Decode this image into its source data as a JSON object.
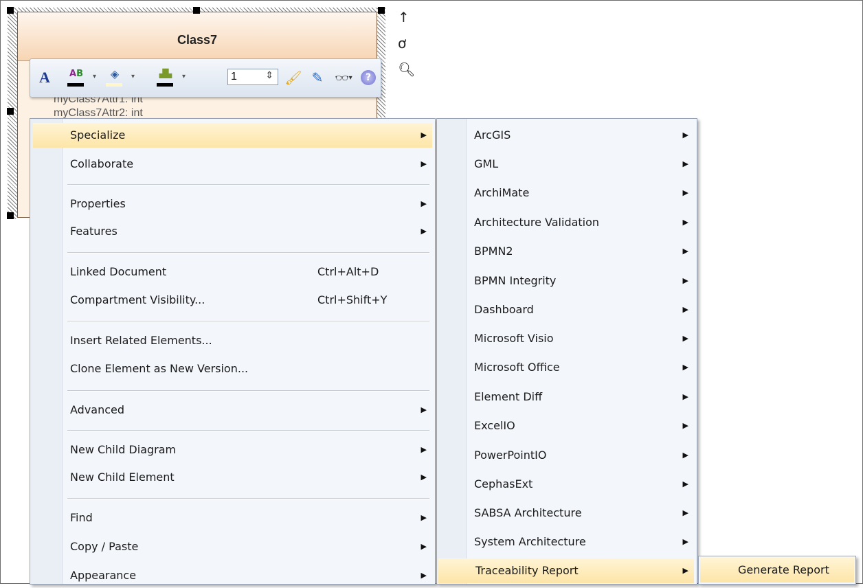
{
  "class_element": {
    "name": "Class7",
    "attributes": [
      "myClass7Attr1: int",
      "myClass7Attr2: int"
    ]
  },
  "side_tools": {
    "arrow_icon": "up-arrow",
    "link_icon": "link",
    "zoom_icon": "magnifier"
  },
  "toolbar": {
    "line_width": "1",
    "icons": [
      "font-icon",
      "font-color-icon",
      "fill-color-icon",
      "line-color-icon",
      "line-width-spinner",
      "format-painter-icon",
      "eyedropper-icon",
      "appearance-icon",
      "help-icon"
    ]
  },
  "context_menu": {
    "items": [
      {
        "label": "Specialize",
        "submenu": true
      },
      {
        "label": "Collaborate",
        "submenu": true
      },
      {
        "label": "Properties",
        "submenu": true
      },
      {
        "label": "Features",
        "submenu": true
      },
      {
        "label": "Linked Document",
        "shortcut": "Ctrl+Alt+D"
      },
      {
        "label": "Compartment Visibility...",
        "shortcut": "Ctrl+Shift+Y"
      },
      {
        "label": "Insert Related Elements..."
      },
      {
        "label": "Clone Element as New Version..."
      },
      {
        "label": "Advanced",
        "submenu": true
      },
      {
        "label": "New Child Diagram",
        "submenu": true
      },
      {
        "label": "New Child Element",
        "submenu": true
      },
      {
        "label": "Find",
        "submenu": true
      },
      {
        "label": "Copy / Paste",
        "submenu": true
      },
      {
        "label": "Appearance",
        "submenu": true
      }
    ]
  },
  "specialize_menu": {
    "items": [
      {
        "label": "ArcGIS"
      },
      {
        "label": "GML"
      },
      {
        "label": "ArchiMate"
      },
      {
        "label": "Architecture Validation"
      },
      {
        "label": "BPMN2"
      },
      {
        "label": "BPMN Integrity"
      },
      {
        "label": "Dashboard"
      },
      {
        "label": "Microsoft Visio"
      },
      {
        "label": "Microsoft Office"
      },
      {
        "label": "Element Diff"
      },
      {
        "label": "ExcelIO"
      },
      {
        "label": "PowerPointIO"
      },
      {
        "label": "CephasExt"
      },
      {
        "label": "SABSA Architecture"
      },
      {
        "label": "System Architecture"
      },
      {
        "label": "Traceability Report"
      }
    ]
  },
  "traceability_menu": {
    "items": [
      {
        "label": "Generate Report"
      }
    ]
  },
  "submenu_arrow": "▶",
  "colors": {
    "highlight": "#fde5a8",
    "menu_bg": "#f3f6fb",
    "class_header": "#f7d5b3"
  }
}
